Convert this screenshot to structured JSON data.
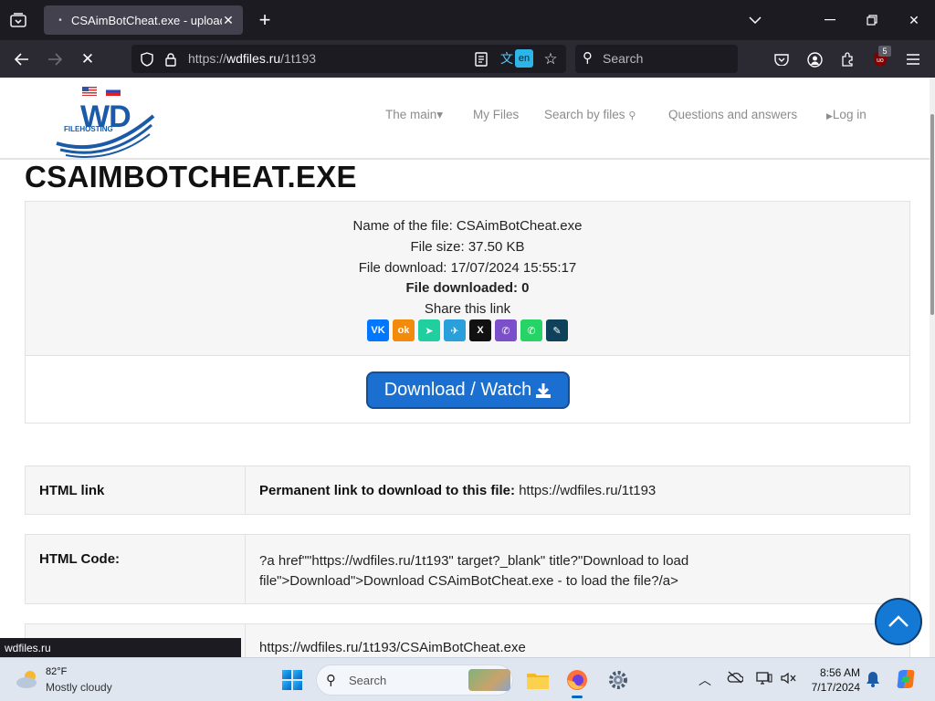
{
  "browser": {
    "tab_title": "CSAimBotCheat.exe - upload fi",
    "url_prefix": "https://",
    "url_domain": "wdfiles.ru",
    "url_path": "/1t193",
    "search_placeholder": "Search",
    "translate_lang": "en",
    "extension_badge": "5",
    "status_url": "wdfiles.ru"
  },
  "site": {
    "menu": {
      "main": "The main▾",
      "my_files": "My Files",
      "search": "Search by files",
      "qa": "Questions and answers",
      "login": "Log in"
    },
    "logo_text": "WD",
    "logo_sub": "FILEHOSTING"
  },
  "file": {
    "title": "CSAIMBOTCHEAT.EXE",
    "name_line": "Name of the file: CSAimBotCheat.exe",
    "size_line": "File size: 37.50 KB",
    "date_line": "File download: 17/07/2024 15:55:17",
    "downloaded_line": "File downloaded: 0",
    "share_label": "Share this link",
    "download_button": "Download / Watch"
  },
  "share_buttons": [
    {
      "name": "vk",
      "glyph": "VK",
      "color": "#0077ff"
    },
    {
      "name": "odnoklassniki",
      "glyph": "ok",
      "color": "#f28b0c"
    },
    {
      "name": "messenger",
      "glyph": "➤",
      "color": "#1fcfa0"
    },
    {
      "name": "telegram",
      "glyph": "✈",
      "color": "#2aa0da"
    },
    {
      "name": "x",
      "glyph": "X",
      "color": "#111111"
    },
    {
      "name": "viber",
      "glyph": "✆",
      "color": "#7b4fc9"
    },
    {
      "name": "whatsapp",
      "glyph": "✆",
      "color": "#25d366"
    },
    {
      "name": "livejournal",
      "glyph": "✎",
      "color": "#0d425a"
    }
  ],
  "links": {
    "html_link_label": "HTML link",
    "html_link_prefix": "Permanent link to download to this file:",
    "html_link_value": "https://wdfiles.ru/1t193",
    "html_code_label": "HTML Code:",
    "html_code_line1": "?a href\"\"https://wdfiles.ru/1t193\" target?_blank\" title?\"Download to load",
    "html_code_line2": "file\">Download\">Download CSAimBotCheat.exe - to load the file?/a>",
    "direct_value": "https://wdfiles.ru/1t193/CSAimBotCheat.exe"
  },
  "taskbar": {
    "temperature": "82°F",
    "weather": "Mostly cloudy",
    "search_placeholder": "Search",
    "time": "8:56 AM",
    "date": "7/17/2024"
  }
}
